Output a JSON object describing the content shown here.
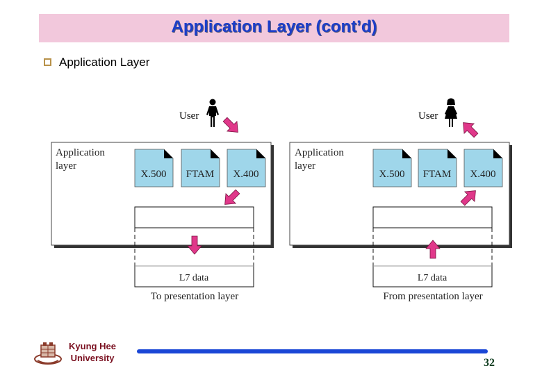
{
  "slide": {
    "title": "Application Layer (cont’d)",
    "bullet": "Application Layer",
    "page_number": "32"
  },
  "footer": {
    "university_line1": "Kyung Hee",
    "university_line2": "University"
  },
  "diagram_left": {
    "user_label": "User",
    "layer_label_line1": "Application",
    "layer_label_line2": "layer",
    "services": [
      "X.500",
      "FTAM",
      "X.400"
    ],
    "data_label": "L7 data",
    "caption": "To presentation layer",
    "direction": "down"
  },
  "diagram_right": {
    "user_label": "User",
    "layer_label_line1": "Application",
    "layer_label_line2": "layer",
    "services": [
      "X.500",
      "FTAM",
      "X.400"
    ],
    "data_label": "L7 data",
    "caption": "From presentation layer",
    "direction": "up"
  },
  "colors": {
    "title_band": "#f2c8dc",
    "title_text": "#1c3ec8",
    "arrow": "#e0388a",
    "service_box": "#9fd6ea",
    "footer_line": "#1a46d6",
    "university_text": "#7a1020"
  }
}
